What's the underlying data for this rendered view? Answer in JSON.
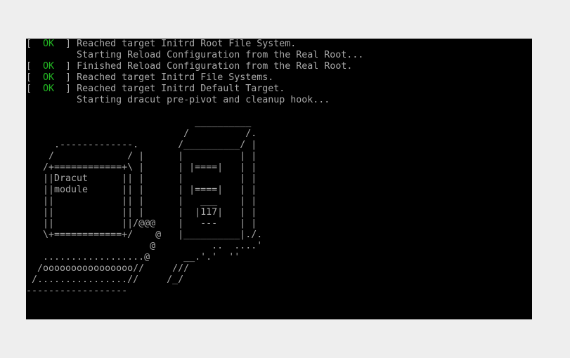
{
  "console": {
    "log": [
      {
        "open": "[  ",
        "status": "OK",
        "close": "  ] ",
        "message": "Reached target Initrd Root File System."
      },
      {
        "open": "",
        "status": "",
        "close": "",
        "message": "         Starting Reload Configuration from the Real Root..."
      },
      {
        "open": "[  ",
        "status": "OK",
        "close": "  ] ",
        "message": "Finished Reload Configuration from the Real Root."
      },
      {
        "open": "[  ",
        "status": "OK",
        "close": "  ] ",
        "message": "Reached target Initrd File Systems."
      },
      {
        "open": "[  ",
        "status": "OK",
        "close": "  ] ",
        "message": "Reached target Initrd Default Target."
      },
      {
        "open": "",
        "status": "",
        "close": "",
        "message": "         Starting dracut pre-pivot and cleanup hook..."
      }
    ],
    "ascii_art": [
      "                              __________",
      "                            /          /.",
      "     .-------------.       /__________/ |",
      "    /             / |      |          | |",
      "   /+============+\\ |      | |====|   | |",
      "   ||Dracut      || |      |          | |",
      "   ||module      || |      | |====|   | |",
      "   ||            || |      |   ___    | |",
      "   ||            || |      |  |117|   | |",
      "   ||            ||/@@@    |   ---    | |",
      "   \\+============+/    @   |__________|./.",
      "                      @          ..  ....'",
      "   ..................@      __.'.'  ''",
      "  /oooooooooooooooo//     ///",
      " /................//     /_/",
      "------------------"
    ],
    "colors": {
      "background": "#000000",
      "text": "#aaaaaa",
      "ok": "#22b722"
    }
  }
}
